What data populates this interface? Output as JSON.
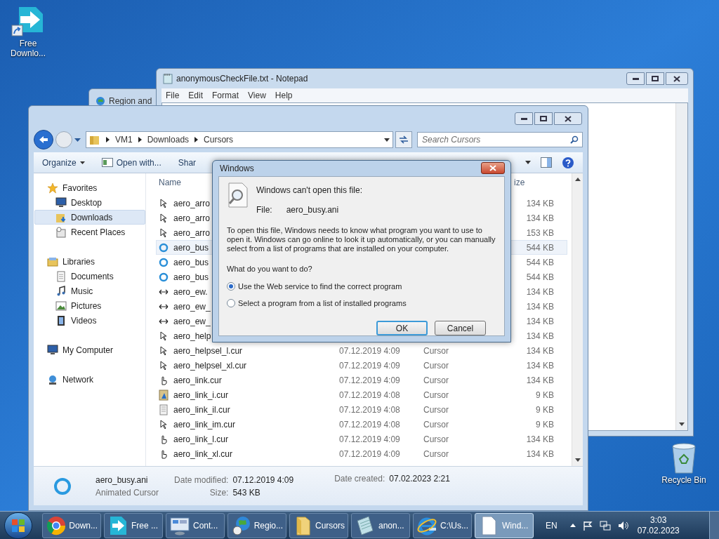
{
  "desktop": {
    "icons": [
      {
        "label": "Free Downlo...",
        "kind": "app"
      },
      {
        "label": "Recycle Bin",
        "kind": "bin"
      }
    ]
  },
  "region_window": {
    "title": "Region and"
  },
  "notepad": {
    "title": "anonymousCheckFile.txt - Notepad",
    "menu": [
      "File",
      "Edit",
      "Format",
      "View",
      "Help"
    ]
  },
  "explorer": {
    "path": [
      "VM1",
      "Downloads",
      "Cursors"
    ],
    "search": {
      "placeholder": "Search Cursors"
    },
    "toolbar": [
      "Organize",
      "Open with...",
      "Shar"
    ],
    "nav": [
      {
        "label": "Favorites",
        "kind": "star",
        "items": [
          {
            "label": "Desktop",
            "kind": "desktop",
            "selected": false
          },
          {
            "label": "Downloads",
            "kind": "downloads",
            "selected": true
          },
          {
            "label": "Recent Places",
            "kind": "recent",
            "selected": false
          }
        ]
      },
      {
        "label": "Libraries",
        "kind": "library",
        "items": [
          {
            "label": "Documents",
            "kind": "documents",
            "selected": false
          },
          {
            "label": "Music",
            "kind": "music",
            "selected": false
          },
          {
            "label": "Pictures",
            "kind": "pictures",
            "selected": false
          },
          {
            "label": "Videos",
            "kind": "videos",
            "selected": false
          }
        ]
      },
      {
        "label": "My Computer",
        "kind": "computer"
      },
      {
        "label": "Network",
        "kind": "network"
      }
    ],
    "columns": [
      "Name",
      "ize"
    ],
    "rows": [
      {
        "kind": "arrow",
        "name": "aero_arro",
        "size": "134 KB",
        "selected": false
      },
      {
        "kind": "arrow",
        "name": "aero_arro",
        "size": "134 KB",
        "selected": false
      },
      {
        "kind": "arrow",
        "name": "aero_arro",
        "size": "153 KB",
        "selected": false
      },
      {
        "kind": "ring",
        "name": "aero_bus",
        "size": "544 KB",
        "selected": true
      },
      {
        "kind": "ring",
        "name": "aero_bus",
        "size": "544 KB",
        "selected": false
      },
      {
        "kind": "ring",
        "name": "aero_bus",
        "size": "544 KB",
        "selected": false
      },
      {
        "kind": "resize",
        "name": "aero_ew.",
        "size": "134 KB",
        "selected": false
      },
      {
        "kind": "resize",
        "name": "aero_ew_",
        "size": "134 KB",
        "selected": false
      },
      {
        "kind": "resize",
        "name": "aero_ew_",
        "size": "134 KB",
        "selected": false
      },
      {
        "kind": "arrow",
        "name": "aero_help",
        "size": "134 KB",
        "selected": false
      },
      {
        "kind": "arrow",
        "name": "aero_helpsel_l.cur",
        "date": "07.12.2019 4:09",
        "type": "Cursor",
        "size": "134 KB",
        "selected": false
      },
      {
        "kind": "arrow",
        "name": "aero_helpsel_xl.cur",
        "date": "07.12.2019 4:09",
        "type": "Cursor",
        "size": "134 KB",
        "selected": false
      },
      {
        "kind": "hand",
        "name": "aero_link.cur",
        "date": "07.12.2019 4:09",
        "type": "Cursor",
        "size": "134 KB",
        "selected": false
      },
      {
        "kind": "image",
        "name": "aero_link_i.cur",
        "date": "07.12.2019 4:08",
        "type": "Cursor",
        "size": "9 KB",
        "selected": false
      },
      {
        "kind": "doc",
        "name": "aero_link_il.cur",
        "date": "07.12.2019 4:08",
        "type": "Cursor",
        "size": "9 KB",
        "selected": false
      },
      {
        "kind": "arrow",
        "name": "aero_link_im.cur",
        "date": "07.12.2019 4:08",
        "type": "Cursor",
        "size": "9 KB",
        "selected": false
      },
      {
        "kind": "hand",
        "name": "aero_link_l.cur",
        "date": "07.12.2019 4:09",
        "type": "Cursor",
        "size": "134 KB",
        "selected": false
      },
      {
        "kind": "hand",
        "name": "aero_link_xl.cur",
        "date": "07.12.2019 4:09",
        "type": "Cursor",
        "size": "134 KB",
        "selected": false
      }
    ],
    "details": {
      "name": "aero_busy.ani",
      "type": "Animated Cursor",
      "fields": [
        {
          "label": "Date modified:",
          "value": "07.12.2019 4:09"
        },
        {
          "label": "Size:",
          "value": "543 KB"
        },
        {
          "label": "Date created:",
          "value": "07.02.2023 2:21"
        }
      ]
    }
  },
  "dialog": {
    "title": "Windows",
    "heading": "Windows can't open this file:",
    "file_label": "File:",
    "file_name": "aero_busy.ani",
    "message": "To open this file, Windows needs to know what program you want to use to open it. Windows can go online to look it up automatically, or you can manually select from a list of programs that are installed on your computer.",
    "question": "What do you want to do?",
    "options": [
      {
        "label": "Use the Web service to find the correct program",
        "selected": true
      },
      {
        "label": "Select a program from a list of installed programs",
        "selected": false
      }
    ],
    "buttons": [
      {
        "label": "OK",
        "default": true
      },
      {
        "label": "Cancel",
        "default": false
      }
    ]
  },
  "taskbar": {
    "items": [
      {
        "label": "Down...",
        "kind": "chrome",
        "selected": false
      },
      {
        "label": "Free ...",
        "kind": "app",
        "selected": false
      },
      {
        "label": "Cont...",
        "kind": "control",
        "selected": false
      },
      {
        "label": "Regio...",
        "kind": "globe",
        "selected": false
      },
      {
        "label": "Cursors",
        "kind": "folder",
        "selected": false
      },
      {
        "label": "anon...",
        "kind": "notepad",
        "selected": false
      },
      {
        "label": "C:\\Us...",
        "kind": "ie",
        "selected": false
      },
      {
        "label": "Wind...",
        "kind": "file",
        "selected": true
      }
    ],
    "language": "EN",
    "time": "3:03",
    "date": "07.02.2023"
  }
}
